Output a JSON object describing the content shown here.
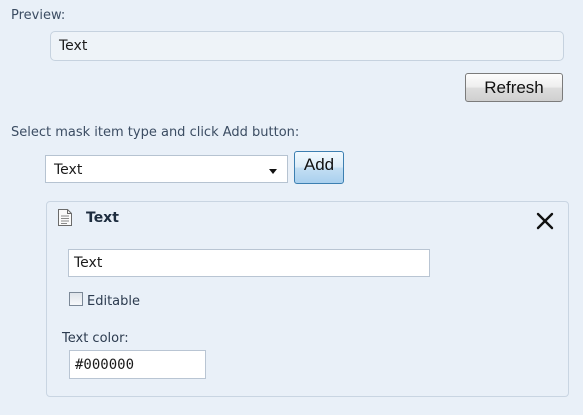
{
  "preview": {
    "label": "Preview:",
    "value": "Text"
  },
  "refresh_button": "Refresh",
  "add_section": {
    "instruction": "Select mask item type and click Add button:",
    "selected_type": "Text",
    "add_button": "Add"
  },
  "mask_item": {
    "icon": "document-icon",
    "title": "Text",
    "close_icon": "close-icon",
    "text_value": "Text",
    "editable_label": "Editable",
    "editable_checked": false,
    "color_label": "Text color:",
    "color_value": "#000000"
  }
}
